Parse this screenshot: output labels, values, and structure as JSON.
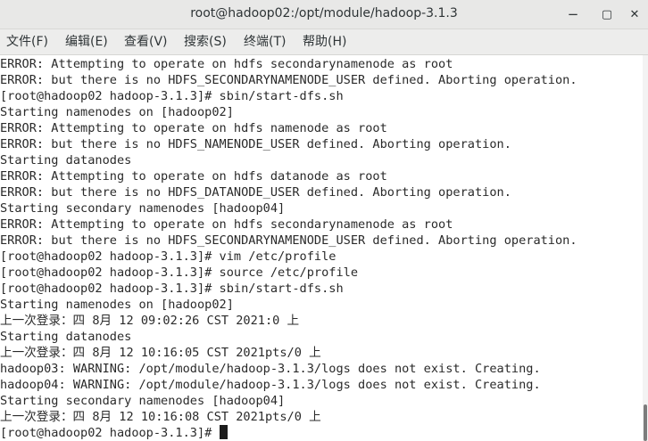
{
  "window": {
    "title": "root@hadoop02:/opt/module/hadoop-3.1.3",
    "minimize_glyph": "−",
    "maximize_glyph": "▢",
    "close_glyph": "✕"
  },
  "menu": {
    "items": [
      {
        "label": "文件(F)"
      },
      {
        "label": "编辑(E)"
      },
      {
        "label": "查看(V)"
      },
      {
        "label": "搜索(S)"
      },
      {
        "label": "终端(T)"
      },
      {
        "label": "帮助(H)"
      }
    ]
  },
  "terminal": {
    "lines": [
      "ERROR: Attempting to operate on hdfs secondarynamenode as root",
      "ERROR: but there is no HDFS_SECONDARYNAMENODE_USER defined. Aborting operation.",
      "[root@hadoop02 hadoop-3.1.3]# sbin/start-dfs.sh",
      "Starting namenodes on [hadoop02]",
      "ERROR: Attempting to operate on hdfs namenode as root",
      "ERROR: but there is no HDFS_NAMENODE_USER defined. Aborting operation.",
      "Starting datanodes",
      "ERROR: Attempting to operate on hdfs datanode as root",
      "ERROR: but there is no HDFS_DATANODE_USER defined. Aborting operation.",
      "Starting secondary namenodes [hadoop04]",
      "ERROR: Attempting to operate on hdfs secondarynamenode as root",
      "ERROR: but there is no HDFS_SECONDARYNAMENODE_USER defined. Aborting operation.",
      "[root@hadoop02 hadoop-3.1.3]# vim /etc/profile",
      "[root@hadoop02 hadoop-3.1.3]# source /etc/profile",
      "[root@hadoop02 hadoop-3.1.3]# sbin/start-dfs.sh",
      "Starting namenodes on [hadoop02]",
      "上一次登录：四 8月 12 09:02:26 CST 2021:0 上",
      "Starting datanodes",
      "上一次登录：四 8月 12 10:16:05 CST 2021pts/0 上",
      "hadoop03: WARNING: /opt/module/hadoop-3.1.3/logs does not exist. Creating.",
      "hadoop04: WARNING: /opt/module/hadoop-3.1.3/logs does not exist. Creating.",
      "Starting secondary namenodes [hadoop04]",
      "上一次登录：四 8月 12 10:16:08 CST 2021pts/0 上"
    ],
    "prompt": "[root@hadoop02 hadoop-3.1.3]# "
  },
  "colors": {
    "titlebar_bg": "#e8e8e7",
    "menubar_bg": "#ededec",
    "terminal_bg": "#ffffff",
    "terminal_fg": "#2a2a2a",
    "cursor": "#1c1c1c",
    "scroll_thumb": "#7c7c7c"
  },
  "icons": {
    "minimize": "minimize-icon",
    "maximize": "maximize-icon",
    "close": "close-icon"
  }
}
